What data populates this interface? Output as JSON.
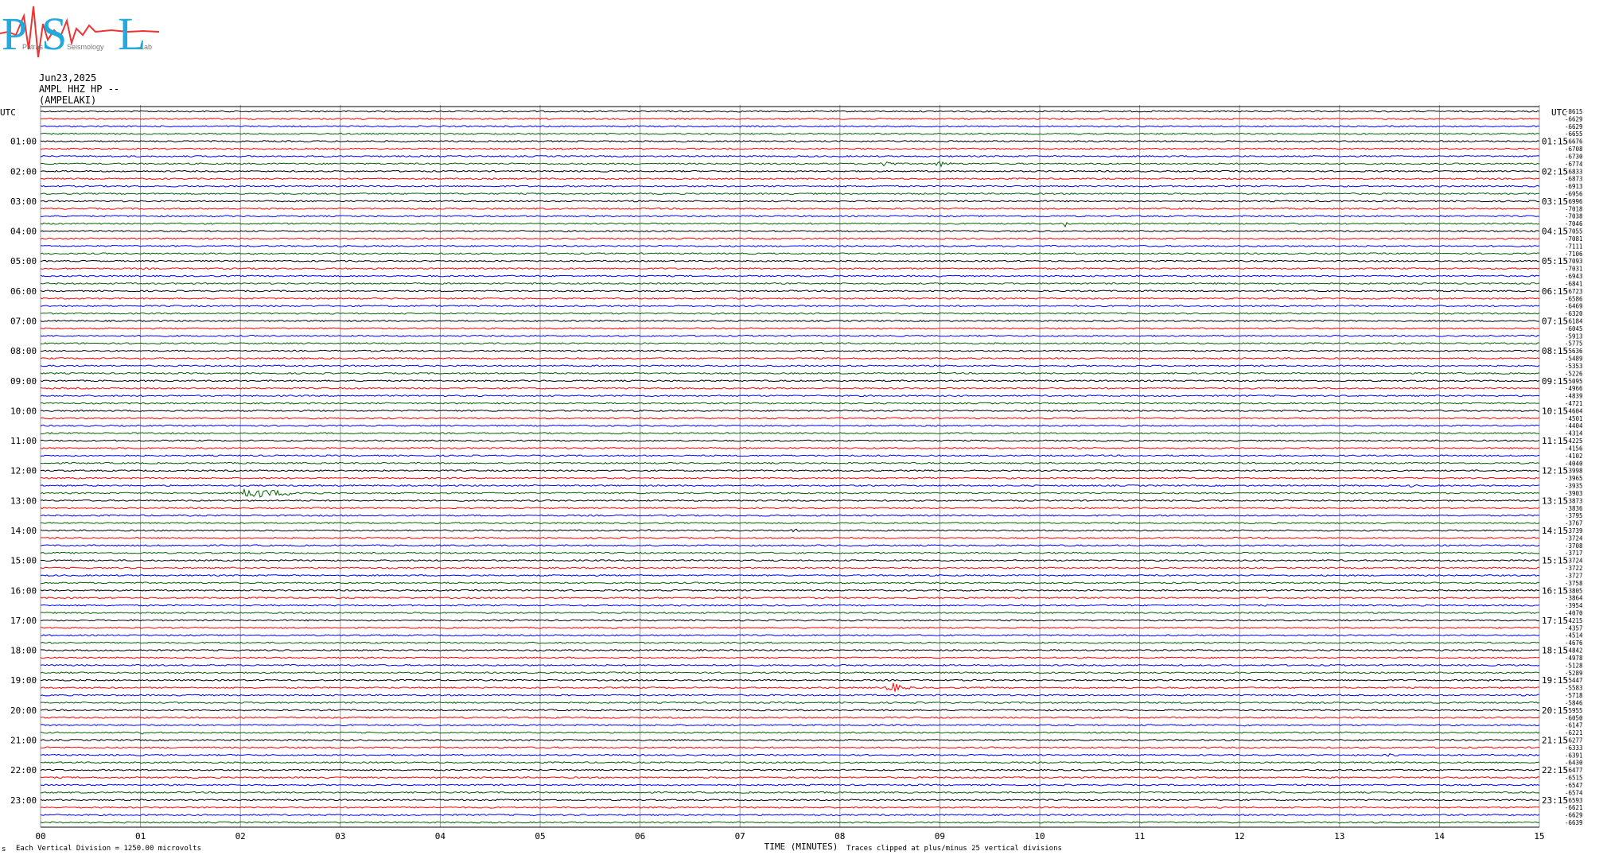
{
  "logo": {
    "letters": [
      "P",
      "S",
      "L"
    ],
    "words": [
      "Patras",
      "Seismology",
      "Lab"
    ]
  },
  "header": {
    "date": "Jun23,2025",
    "channel": "AMPL HHZ HP --",
    "station": "(AMPELAKI)"
  },
  "chart_data": {
    "type": "helicorder",
    "left_axis_title": "UTC",
    "right_axis_title": "UTC",
    "left_hour_labels": [
      "01:00",
      "02:00",
      "03:00",
      "04:00",
      "05:00",
      "06:00",
      "07:00",
      "08:00",
      "09:00",
      "10:00",
      "11:00",
      "12:00",
      "13:00",
      "14:00",
      "15:00",
      "16:00",
      "17:00",
      "18:00",
      "19:00",
      "20:00",
      "21:00",
      "22:00",
      "23:00"
    ],
    "right_hour_labels": [
      "01:15",
      "02:15",
      "03:15",
      "04:15",
      "05:15",
      "06:15",
      "07:15",
      "08:15",
      "09:15",
      "10:15",
      "11:15",
      "12:15",
      "13:15",
      "14:15",
      "15:15",
      "16:15",
      "17:15",
      "18:15",
      "19:15",
      "20:15",
      "21:15",
      "22:15",
      "23:15"
    ],
    "x_ticks": [
      "00",
      "01",
      "02",
      "03",
      "04",
      "05",
      "06",
      "07",
      "08",
      "09",
      "10",
      "11",
      "12",
      "13",
      "14",
      "15"
    ],
    "x_range": [
      0,
      15
    ],
    "xlabel": "TIME (MINUTES)",
    "traces_per_hour": 4,
    "trace_colors": [
      "#000000",
      "#ff0000",
      "#0000ff",
      "#006400"
    ],
    "grid_color": "#999999",
    "offset_labels": [
      "-8615",
      "-6629",
      "-6629",
      "-6655",
      "-6676",
      "-6708",
      "-6730",
      "-6774",
      "-6833",
      "-6873",
      "-6913",
      "-6956",
      "-6996",
      "-7018",
      "-7038",
      "-7046",
      "-7055",
      "-7081",
      "-7111",
      "-7106",
      "-7093",
      "-7031",
      "-6943",
      "-6841",
      "-6723",
      "-6586",
      "-6469",
      "-6320",
      "-6184",
      "-6045",
      "-5913",
      "-5775",
      "-5636",
      "-5489",
      "-5353",
      "-5226",
      "-5095",
      "-4966",
      "-4839",
      "-4721",
      "-4604",
      "-4501",
      "-4404",
      "-4314",
      "-4225",
      "-4156",
      "-4102",
      "-4040",
      "-3998",
      "-3965",
      "-3935",
      "-3903",
      "-3873",
      "-3836",
      "-3795",
      "-3767",
      "-3739",
      "-3724",
      "-3708",
      "-3717",
      "-3724",
      "-3722",
      "-3727",
      "-3758",
      "-3805",
      "-3864",
      "-3954",
      "-4070",
      "-4215",
      "-4357",
      "-4514",
      "-4676",
      "-4842",
      "-4978",
      "-5128",
      "-5289",
      "-5447",
      "-5583",
      "-5718",
      "-5846",
      "-5955",
      "-6050",
      "-6147",
      "-6221",
      "-6277",
      "-6333",
      "-6391",
      "-6430",
      "-6477",
      "-6515",
      "-6547",
      "-6574",
      "-6593",
      "-6621",
      "-6629",
      "-6639"
    ],
    "events": [
      {
        "trace": 7,
        "start_min": 8.4,
        "end_min": 8.7,
        "amplitude": 7
      },
      {
        "trace": 7,
        "start_min": 8.95,
        "end_min": 9.3,
        "amplitude": 6
      },
      {
        "trace": 15,
        "start_min": 10.25,
        "end_min": 10.35,
        "amplitude": 5
      },
      {
        "trace": 49,
        "start_min": 8.8,
        "end_min": 10.0,
        "amplitude": 2
      },
      {
        "trace": 50,
        "start_min": 13.7,
        "end_min": 13.95,
        "amplitude": 3
      },
      {
        "trace": 51,
        "start_min": 2.0,
        "end_min": 3.2,
        "amplitude": 9
      },
      {
        "trace": 56,
        "start_min": 6.05,
        "end_min": 6.3,
        "amplitude": 2
      },
      {
        "trace": 56,
        "start_min": 7.5,
        "end_min": 7.9,
        "amplitude": 3
      },
      {
        "trace": 57,
        "start_min": 12.55,
        "end_min": 12.9,
        "amplitude": 2
      },
      {
        "trace": 72,
        "start_min": 6.6,
        "end_min": 6.7,
        "amplitude": 2
      },
      {
        "trace": 76,
        "start_min": 14.45,
        "end_min": 14.6,
        "amplitude": 3
      },
      {
        "trace": 77,
        "start_min": 8.45,
        "end_min": 8.85,
        "amplitude": 11
      },
      {
        "trace": 82,
        "start_min": 12.05,
        "end_min": 12.2,
        "amplitude": 3
      },
      {
        "trace": 83,
        "start_min": 1.0,
        "end_min": 1.25,
        "amplitude": 3
      },
      {
        "trace": 86,
        "start_min": 11.2,
        "end_min": 11.3,
        "amplitude": 2
      },
      {
        "trace": 86,
        "start_min": 13.45,
        "end_min": 13.95,
        "amplitude": 3
      }
    ]
  },
  "footer": {
    "corner_mark": "s",
    "division_note": "Each Vertical Division = 1250.00 microvolts",
    "clip_note": "Traces clipped at plus/minus 25 vertical divisions"
  }
}
